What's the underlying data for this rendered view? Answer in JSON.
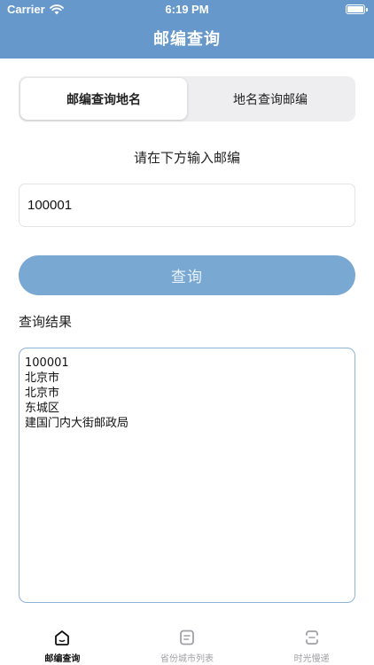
{
  "status_bar": {
    "carrier": "Carrier",
    "time": "6:19 PM",
    "wifi_icon": "wifi-icon",
    "battery_icon": "battery-icon"
  },
  "nav": {
    "title": "邮编查询"
  },
  "segment": {
    "items": [
      {
        "label": "邮编查询地名",
        "selected": true
      },
      {
        "label": "地名查询邮编",
        "selected": false
      }
    ]
  },
  "form": {
    "prompt": "请在下方输入邮编",
    "input_value": "100001",
    "button_label": "查询"
  },
  "result": {
    "label": "查询结果",
    "lines": [
      "100001",
      "北京市",
      "北京市",
      "东城区",
      "建国门内大街邮政局"
    ]
  },
  "tabbar": {
    "items": [
      {
        "label": "邮编查询",
        "icon": "home-icon",
        "active": true
      },
      {
        "label": "省份城市列表",
        "icon": "list-icon",
        "active": false
      },
      {
        "label": "时光慢递",
        "icon": "mail-icon",
        "active": false
      }
    ]
  },
  "colors": {
    "accent": "#6698cb",
    "button": "#79a8d3",
    "result_border": "#8fb3d8"
  }
}
